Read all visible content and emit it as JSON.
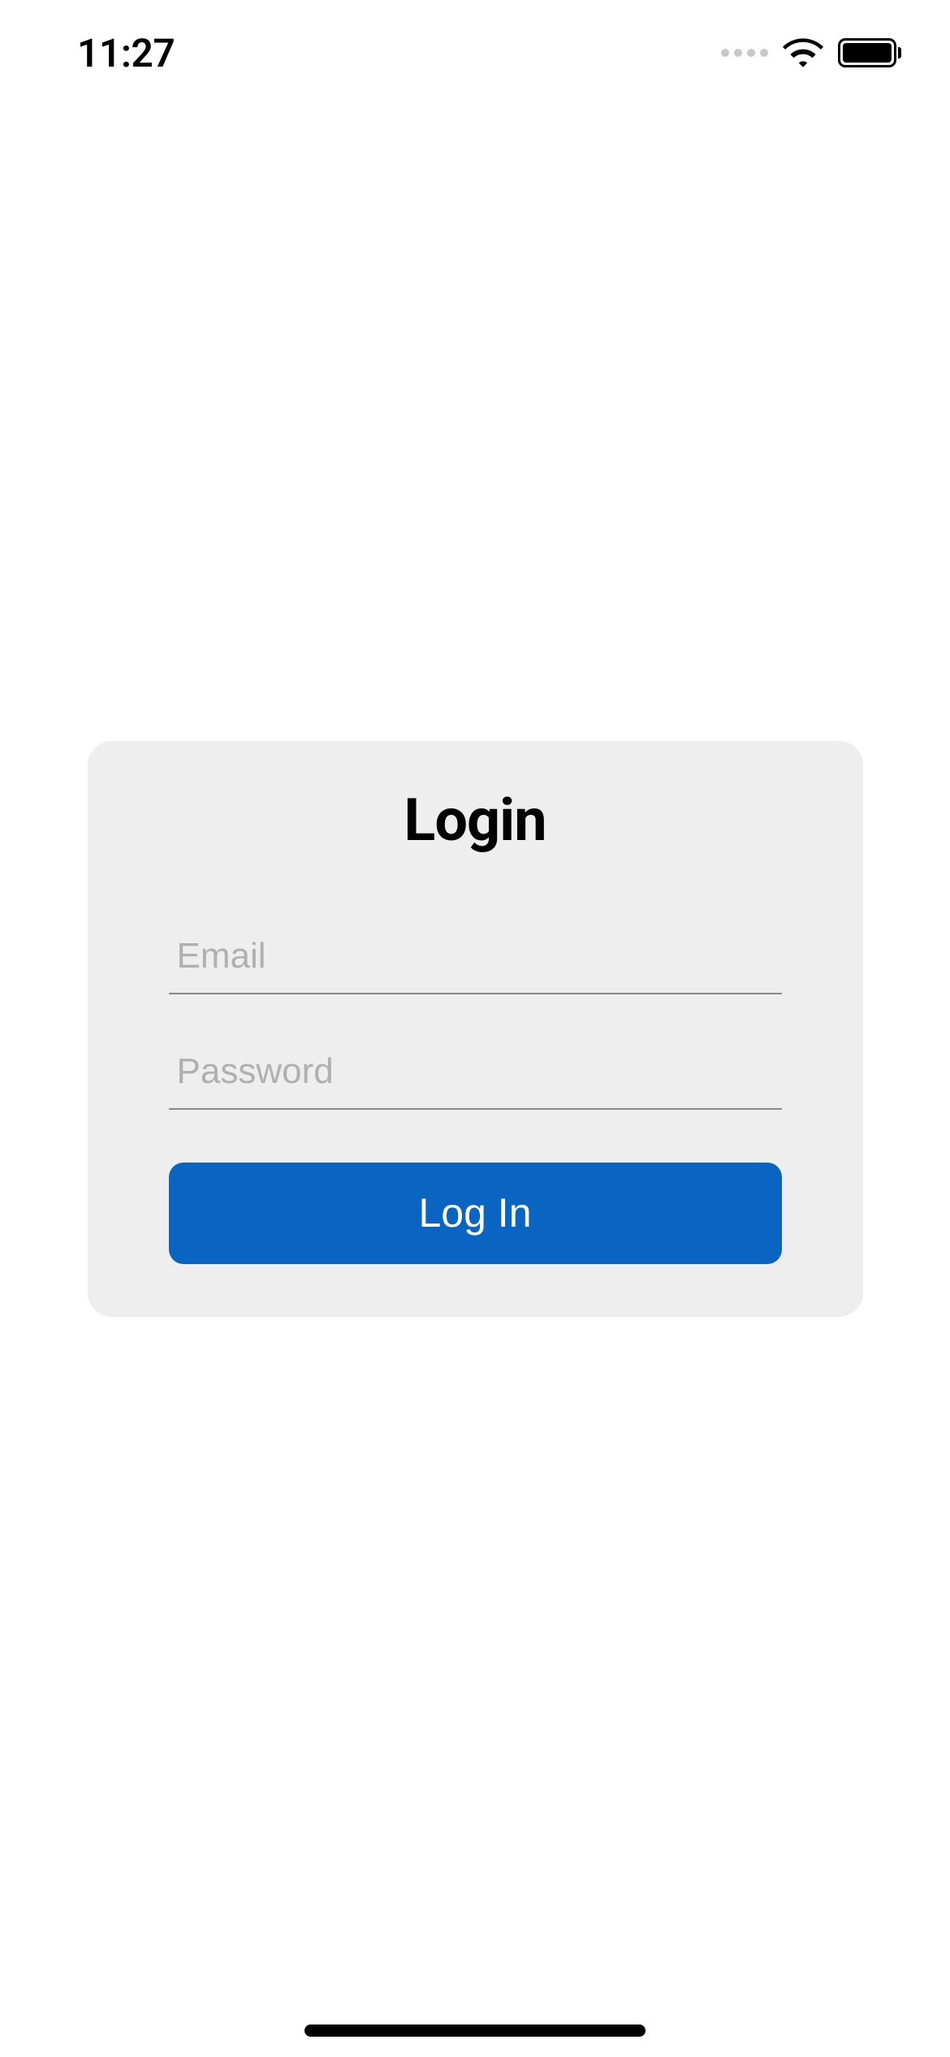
{
  "statusBar": {
    "time": "11:27"
  },
  "login": {
    "title": "Login",
    "emailPlaceholder": "Email",
    "emailValue": "",
    "passwordPlaceholder": "Password",
    "passwordValue": "",
    "buttonLabel": "Log In"
  }
}
